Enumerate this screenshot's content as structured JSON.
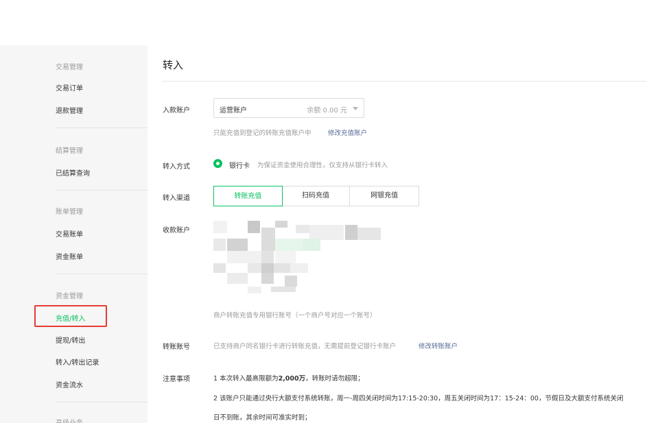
{
  "sidebar": {
    "groups": [
      {
        "title": "交易管理",
        "items": [
          "交易订单",
          "退款管理"
        ]
      },
      {
        "title": "结算管理",
        "items": [
          "已结算查询"
        ]
      },
      {
        "title": "账单管理",
        "items": [
          "交易账单",
          "资金账单"
        ]
      },
      {
        "title": "资金管理",
        "items": [
          "充值/转入",
          "提现/转出",
          "转入/转出记录",
          "资金流水"
        ]
      },
      {
        "title": "高级业务",
        "items": []
      }
    ],
    "active_item": "充值/转入"
  },
  "page": {
    "title": "转入"
  },
  "form": {
    "account_label": "入款账户",
    "account_value": "运营账户",
    "account_balance": "余额 0.00 元",
    "account_hint": "只能充值到登记的转账充值账户中",
    "account_link": "修改充值账户",
    "method_label": "转入方式",
    "method_option": "银行卡",
    "method_hint": "为保证资金使用合理性，仅支持从银行卡转入",
    "channel_label": "转入渠道",
    "channels": [
      "转账充值",
      "扫码充值",
      "网银充值"
    ],
    "channel_active": 0,
    "payee_label": "收款账户",
    "payee_hint": "商户转账充值专用银行账号（一个商户号对应一个账号）",
    "transfer_label": "转账账号",
    "transfer_hint": "已支持商户同名银行卡进行转账充值，无需提前登记银行卡账户",
    "transfer_link": "修改转账账户",
    "notes_label": "注意事项",
    "note1_pre": "1 本次转入最高限额为",
    "note1_bold": "2,000万",
    "note1_post": "，转账时请勿超限；",
    "note2": "2 该账户只能通过央行大额支付系统转账，周一-周四关闭时间为17:15-20:30，周五关闭时间为17：15-24：00，节假日及大额支付系统关闭",
    "note3": "日不到账，其余时间可准实时到；"
  },
  "colors": {
    "accent": "#07c160",
    "link": "#576b95",
    "highlight_box": "#e53935"
  }
}
